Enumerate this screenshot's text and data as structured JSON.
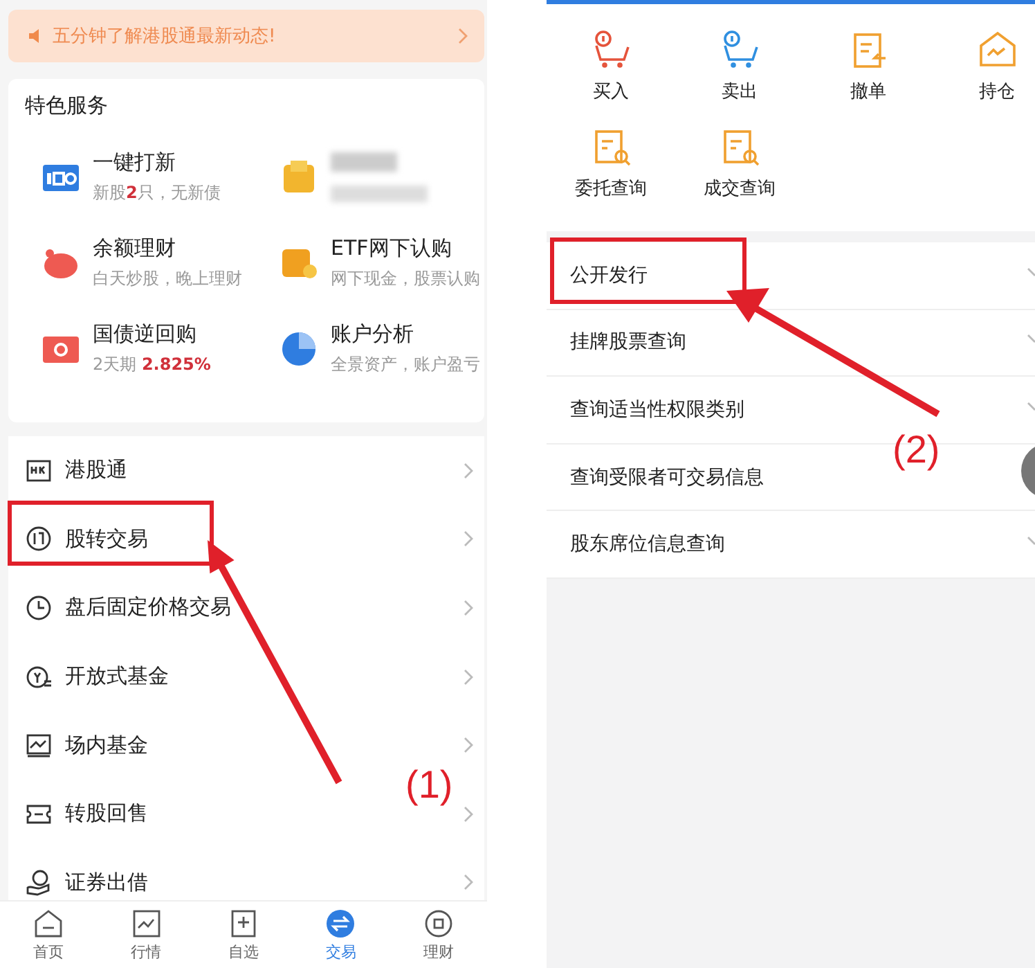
{
  "left_screen": {
    "banner": {
      "text": "五分钟了解港股通最新动态!"
    },
    "featured": {
      "title": "特色服务",
      "items": [
        {
          "kind": "normal",
          "title": "一键打新",
          "subtitle": "新股**2**只，无新债"
        },
        {
          "kind": "blurred"
        },
        {
          "kind": "normal",
          "title": "余额理财",
          "subtitle": "白天炒股，晚上理财"
        },
        {
          "kind": "normal",
          "title": "ETF网下认购",
          "subtitle": "网下现金，股票认购"
        },
        {
          "kind": "normal",
          "title": "国债逆回购",
          "subtitle": "2天期 **2.825%**"
        },
        {
          "kind": "normal",
          "title": "账户分析",
          "subtitle": "全景资产，账户盈亏"
        }
      ]
    },
    "menu": [
      {
        "label": "港股通"
      },
      {
        "label": "股转交易"
      },
      {
        "label": "盘后固定价格交易"
      },
      {
        "label": "开放式基金"
      },
      {
        "label": "场内基金"
      },
      {
        "label": "转股回售"
      },
      {
        "label": "证券出借"
      }
    ],
    "tab_bar": [
      {
        "label": "首页",
        "selected": false
      },
      {
        "label": "行情",
        "selected": false
      },
      {
        "label": "自选",
        "selected": false
      },
      {
        "label": "交易",
        "selected": true
      },
      {
        "label": "理财",
        "selected": false
      }
    ]
  },
  "right_screen": {
    "actions": [
      {
        "label": "买入"
      },
      {
        "label": "卖出"
      },
      {
        "label": "撤单"
      },
      {
        "label": "持仓"
      },
      {
        "label": "委托查询"
      },
      {
        "label": "成交查询"
      }
    ],
    "menu": [
      {
        "label": "公开发行"
      },
      {
        "label": "挂牌股票查询"
      },
      {
        "label": "查询适当性权限类别"
      },
      {
        "label": "查询受限者可交易信息"
      },
      {
        "label": "股东席位信息查询"
      }
    ]
  },
  "annotations": [
    {
      "label": "(1)"
    },
    {
      "label": "(2)"
    }
  ]
}
